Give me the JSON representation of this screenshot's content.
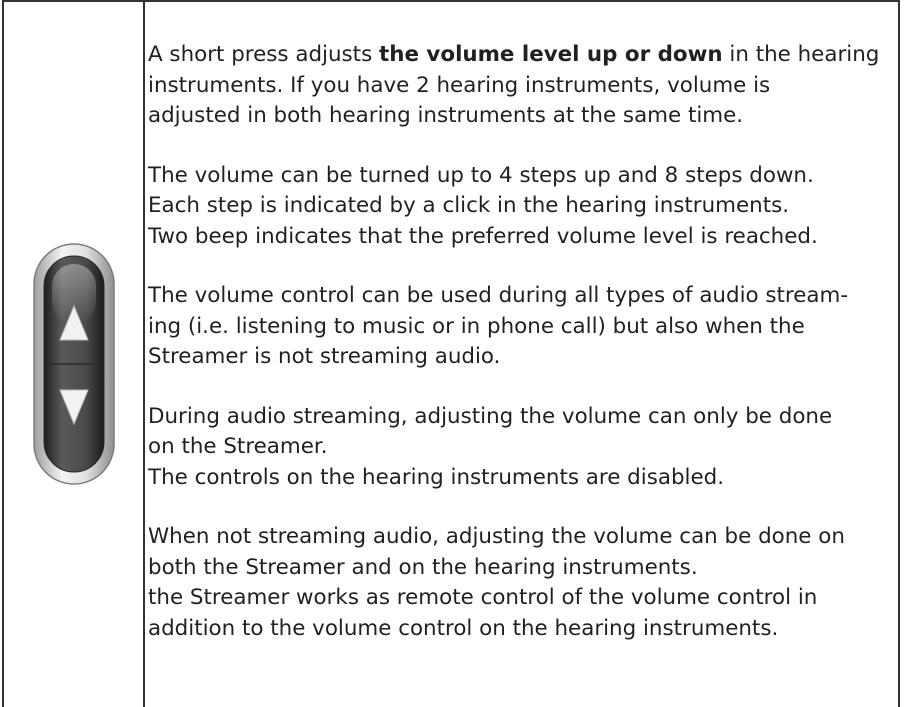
{
  "paragraphs": [
    {
      "lines": [
        {
          "pre": "A short press adjusts ",
          "bold": "the volume level up or down",
          "post": " in the hearing"
        },
        {
          "text": "instruments. If you have 2 hearing instruments, volume is"
        },
        {
          "text": "adjusted in both hearing instruments at the same time."
        }
      ]
    },
    {
      "lines": [
        {
          "text": "The volume can be turned up to 4 steps up and 8 steps down."
        },
        {
          "text": "Each step is indicated by a click in the hearing instruments."
        },
        {
          "text": "Two beep indicates that the preferred volume level is reached."
        }
      ]
    },
    {
      "lines": [
        {
          "text": "The volume control can be used during all types of audio stream-"
        },
        {
          "text": "ing (i.e. listening to music or in phone call) but also when the"
        },
        {
          "text": "Streamer is not streaming audio."
        }
      ]
    },
    {
      "lines": [
        {
          "text": "During audio streaming, adjusting the volume can only be done"
        },
        {
          "text": "on the Streamer."
        },
        {
          "text": "The controls on the hearing instruments are disabled."
        }
      ]
    },
    {
      "lines": [
        {
          "text": "When not streaming audio, adjusting the volume can be done on"
        },
        {
          "text": "both the Streamer and on the hearing instruments."
        },
        {
          "text": "the Streamer works as remote control of the volume control in"
        },
        {
          "text": "addition to the volume control on the hearing instruments."
        }
      ]
    }
  ],
  "icon": {
    "name": "volume-rocker-button-icon",
    "colors": {
      "bezel_outer": "#bdbdbd",
      "bezel_inner": "#e6e6e6",
      "body": "#3a3a3a",
      "arrow": "#f2f2f2"
    }
  }
}
